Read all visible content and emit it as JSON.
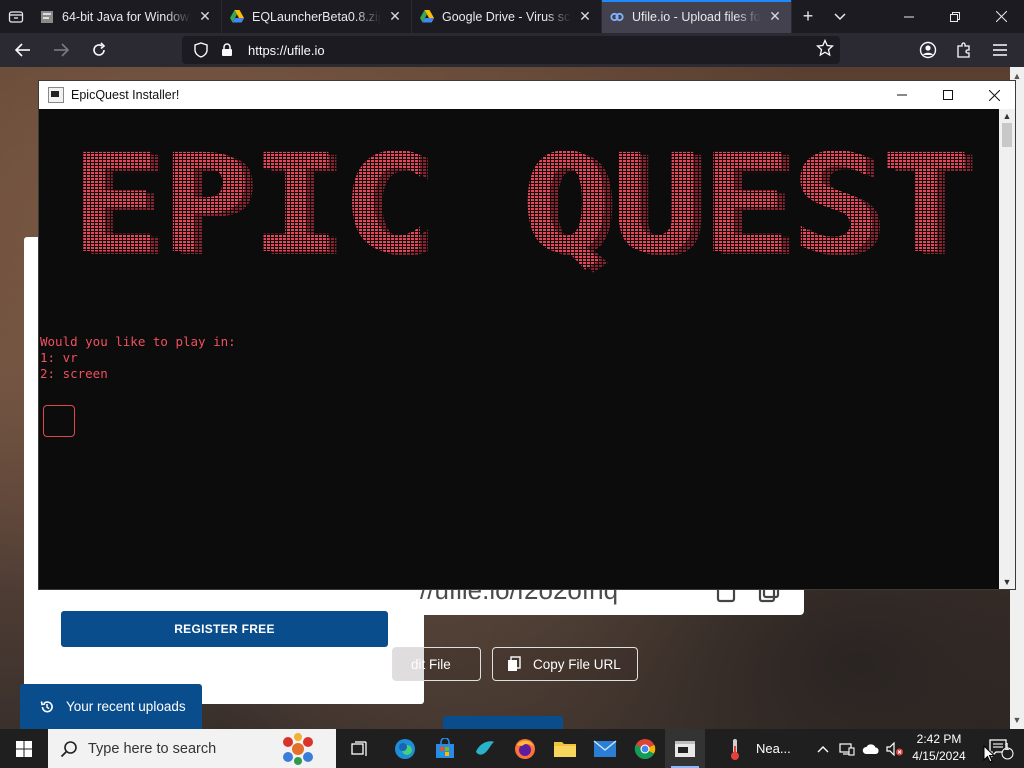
{
  "browser": {
    "tabs": [
      {
        "title": "64-bit Java for Windows",
        "favicon": "java-page-icon",
        "active": false
      },
      {
        "title": "EQLauncherBeta0.8.zip - ",
        "favicon": "google-drive-icon",
        "active": false
      },
      {
        "title": "Google Drive - Virus scan",
        "favicon": "google-drive-icon",
        "active": false
      },
      {
        "title": "Ufile.io - Upload files for f",
        "favicon": "ufile-icon",
        "active": true
      }
    ],
    "url": "https://ufile.io"
  },
  "webpage": {
    "register_label": "REGISTER FREE",
    "file_url_fragment": "//ufile.io/f2o2ofnq",
    "edit_file_label": "dit File",
    "copy_url_label": "Copy File URL",
    "recent_uploads_label": "Your recent uploads"
  },
  "console_window": {
    "title": "EpicQuest Installer!",
    "banner_text": "EPIC QUEST",
    "banner_color": "#e8455a",
    "prompt": "Would you like to play in:",
    "options": [
      "1: vr",
      "2: screen"
    ],
    "input_value": ""
  },
  "taskbar": {
    "search_placeholder": "Type here to search",
    "weather_label": "Nea...",
    "time": "2:42 PM",
    "date": "4/15/2024",
    "notification_count": "1"
  }
}
